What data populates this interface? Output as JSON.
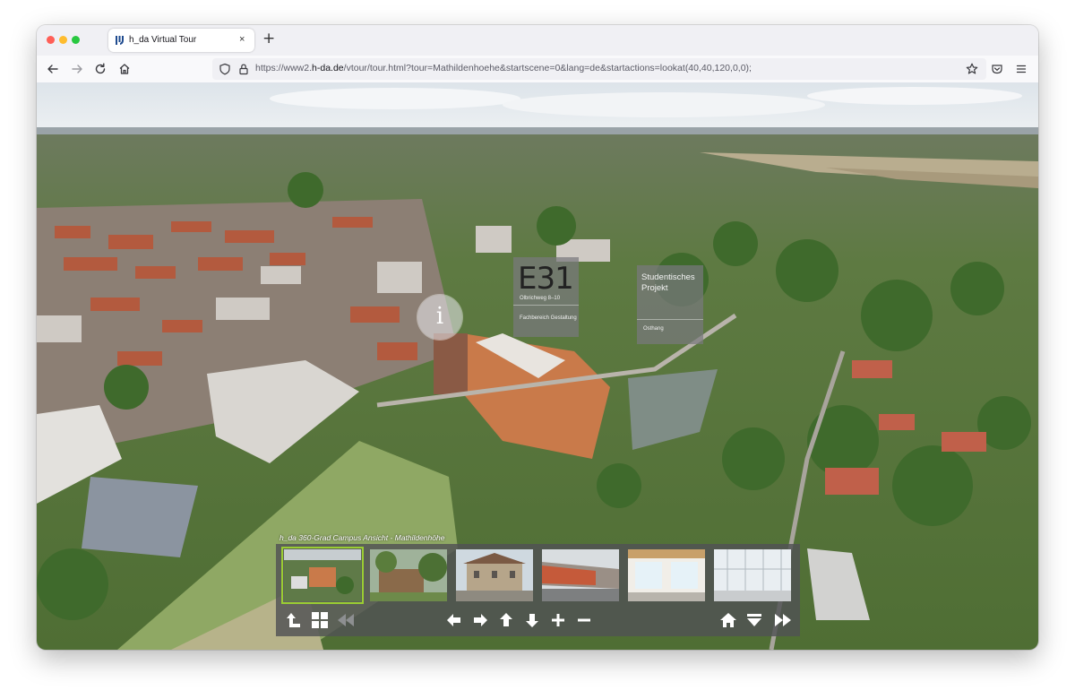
{
  "browser": {
    "tab_title": "h_da Virtual Tour",
    "tab_close": "×",
    "new_tab": "+",
    "url_prefix": "https://www2.",
    "url_host": "h-da.de",
    "url_rest": "/vtour/tour.html?tour=Mathildenhoehe&startscene=0&lang=de&startactions=lookat(40,40,120,0,0);",
    "icons": [
      "back-icon",
      "forward-icon",
      "reload-icon",
      "home-icon",
      "shield-icon",
      "lock-icon",
      "bookmark-star-icon",
      "pocket-icon",
      "menu-icon"
    ]
  },
  "tour": {
    "info_hotspot": "i",
    "poi_e31": {
      "code": "E31",
      "address": "Olbrichweg 8–10",
      "department": "Fachbereich Gestaltung"
    },
    "poi_project": {
      "title": "Studentisches Projekt",
      "location": "Osthang"
    },
    "panel_label": "h_da 360-Grad Campus Ansicht - Mathildenhöhe",
    "thumbnails": [
      {
        "label": "aerial-campus-view",
        "active": true
      },
      {
        "label": "building-with-trees",
        "active": false
      },
      {
        "label": "historic-villa",
        "active": false
      },
      {
        "label": "modern-building-exterior",
        "active": false
      },
      {
        "label": "bright-interior-hall",
        "active": false
      },
      {
        "label": "glass-facade-interior",
        "active": false
      }
    ],
    "controls_left": [
      "up-level-icon",
      "thumbnails-grid-icon",
      "previous-scene-icon"
    ],
    "controls_center": [
      "pan-left-icon",
      "pan-right-icon",
      "pan-up-icon",
      "pan-down-icon",
      "zoom-in-icon",
      "zoom-out-icon"
    ],
    "controls_right": [
      "home-view-icon",
      "hide-panel-icon",
      "next-scene-icon"
    ]
  },
  "colors": {
    "active_thumb_border": "#9acd32",
    "panel_bg": "#505254"
  }
}
